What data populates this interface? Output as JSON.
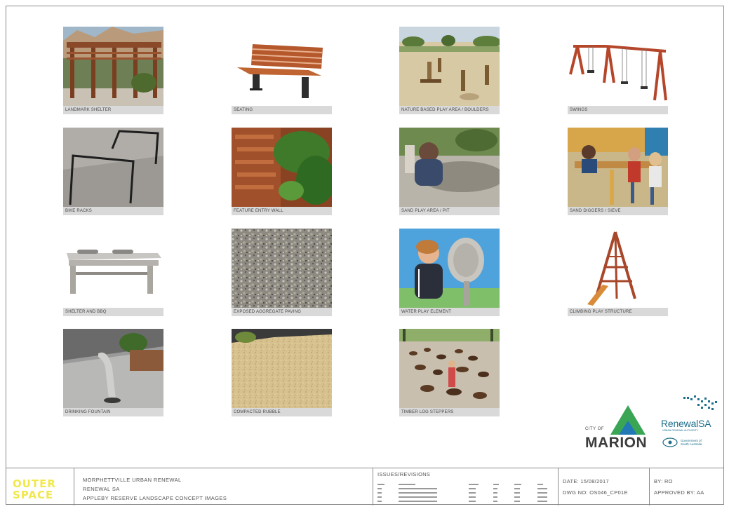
{
  "tiles": [
    {
      "caption": "LANDMARK SHELTER",
      "icon": "shelter-photo"
    },
    {
      "caption": "SEATING",
      "icon": "bench-photo"
    },
    {
      "caption": "NATURE BASED PLAY AREA / BOULDERS",
      "icon": "nature-play-photo"
    },
    {
      "caption": "SWINGS",
      "icon": "swing-set-photo"
    },
    {
      "caption": "BIKE RACKS",
      "icon": "bike-rack-photo"
    },
    {
      "caption": "FEATURE ENTRY WALL",
      "icon": "entry-wall-photo"
    },
    {
      "caption": "SAND PLAY AREA / PIT",
      "icon": "sand-pit-photo"
    },
    {
      "caption": "SAND DIGGERS / SIEVE",
      "icon": "sand-diggers-photo"
    },
    {
      "caption": "SHELTER AND BBQ",
      "icon": "bbq-photo"
    },
    {
      "caption": "EXPOSED AGGREGATE PAVING",
      "icon": "aggregate-paving-photo"
    },
    {
      "caption": "WATER PLAY ELEMENT",
      "icon": "water-play-photo"
    },
    {
      "caption": "CLIMBING PLAY STRUCTURE",
      "icon": "play-structure-photo"
    },
    {
      "caption": "DRINKING FOUNTAIN",
      "icon": "drinking-fountain-photo"
    },
    {
      "caption": "COMPACTED RUBBLE",
      "icon": "rubble-photo"
    },
    {
      "caption": "TIMBER LOG STEPPERS",
      "icon": "log-steppers-photo"
    }
  ],
  "logos": {
    "marion_city": "CITY OF",
    "marion_name": "MARION",
    "renewal_name": "RenewalSA",
    "renewal_sub": "URBAN RENEWAL AUTHORITY",
    "gov_text_1": "Government of",
    "gov_text_2": "South Australia"
  },
  "title_block": {
    "brand_line_1": "OUTER",
    "brand_line_2": "SPACE",
    "project_line_1": "MORPHETTVILLE URBAN RENEWAL",
    "project_line_2": "RENEWAL SA",
    "project_line_3": "APPLEBY RESERVE LANDSCAPE CONCEPT IMAGES",
    "issues_title": "ISSUES/REVISIONS",
    "date": "DATE: 15/08/2017",
    "drawing_no": "DWG NO: OS046_CP01E",
    "by": "BY: RO",
    "approved_by": "APPROVED BY: AA"
  },
  "colors": {
    "brand_yellow": "#f2e84b",
    "marion_green": "#3aa655",
    "marion_blue": "#2277b5",
    "renewal_teal": "#1d6f8c",
    "caption_grey": "#d9d9d9"
  }
}
